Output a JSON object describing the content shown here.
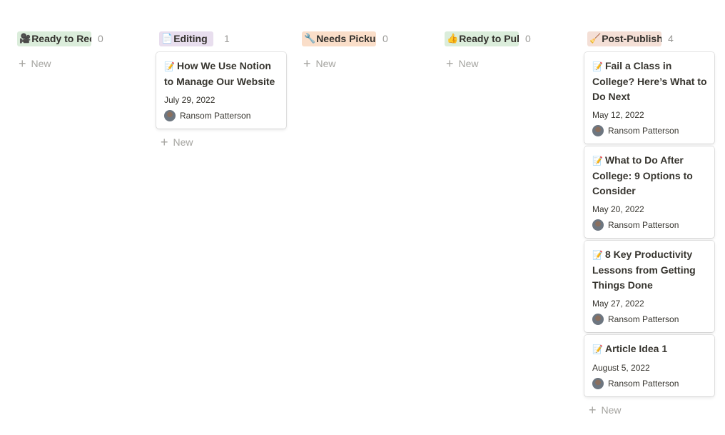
{
  "columns": [
    {
      "label": "Ready to Record",
      "emoji": "🎥",
      "tag_color": "#dbeddb",
      "count": "0",
      "new_label": "New",
      "cards": []
    },
    {
      "label": "Editing",
      "emoji": "📄",
      "tag_color": "#e8deee",
      "count": "1",
      "new_label": "New",
      "cards": [
        {
          "emoji": "📝",
          "title": "How We Use Notion to Manage Our Website",
          "date": "July 29, 2022",
          "person": "Ransom Patterson"
        }
      ]
    },
    {
      "label": "Needs Pickup",
      "emoji": "🔧",
      "tag_color": "#fadec9",
      "count": "0",
      "new_label": "New",
      "cards": []
    },
    {
      "label": "Ready to Publish",
      "emoji": "👍",
      "tag_color": "#dbeddb",
      "count": "0",
      "new_label": "New",
      "cards": []
    },
    {
      "label": "Post-Publish",
      "emoji": "🧹",
      "tag_color": "#f4dfd6",
      "count": "4",
      "new_label": "New",
      "cards": [
        {
          "emoji": "📝",
          "title": "Fail a Class in College? Here’s What to Do Next",
          "date": "May 12, 2022",
          "person": "Ransom Patterson"
        },
        {
          "emoji": "📝",
          "title": "What to Do After College: 9 Options to Consider",
          "date": "May 20, 2022",
          "person": "Ransom Patterson"
        },
        {
          "emoji": "📝",
          "title": "8 Key Productivity Lessons from Getting Things Done",
          "date": "May 27, 2022",
          "person": "Ransom Patterson"
        },
        {
          "emoji": "📝",
          "title": "Article Idea 1",
          "date": "August 5, 2022",
          "person": "Ransom Patterson"
        }
      ]
    }
  ]
}
